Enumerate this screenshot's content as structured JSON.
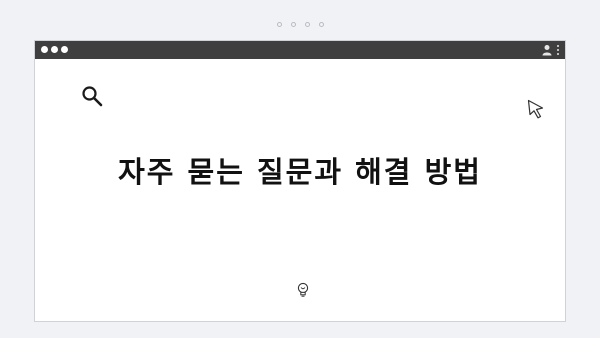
{
  "page": {
    "headline": "자주 묻는 질문과 해결 방법"
  },
  "icons": {
    "search": "search-icon",
    "cursor": "cursor-arrow-icon",
    "user": "user-icon",
    "menu": "kebab-menu-icon",
    "bulb": "lightbulb-icon"
  },
  "colors": {
    "titlebar": "#3f3f3f",
    "background": "#f1f2f5",
    "window": "#ffffff",
    "text": "#111111"
  }
}
